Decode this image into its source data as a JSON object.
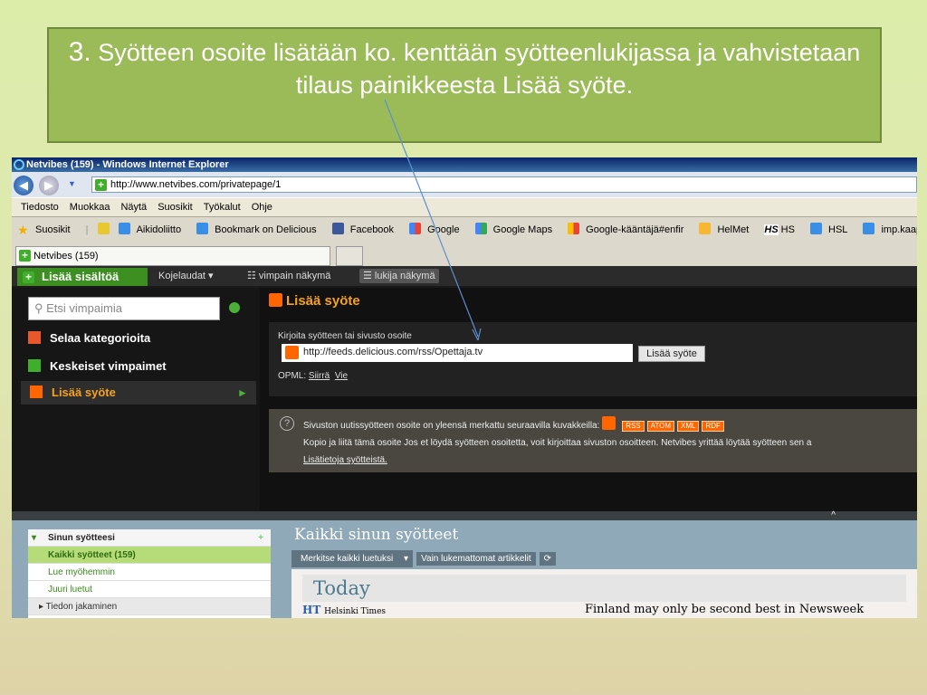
{
  "slide": {
    "number": "3.",
    "text": "Syötteen osoite lisätään ko. kenttään syötteenlukijassa ja vahvistetaan tilaus painikkeesta Lisää syöte."
  },
  "browser": {
    "title": "Netvibes (159) - Windows Internet Explorer",
    "url": "http://www.netvibes.com/privatepage/1",
    "menu": [
      "Tiedosto",
      "Muokkaa",
      "Näytä",
      "Suosikit",
      "Työkalut",
      "Ohje"
    ],
    "favorites_label": "Suosikit",
    "bookmarks": [
      "Aikidoliitto",
      "Bookmark on Delicious",
      "Facebook",
      "Google",
      "Google Maps",
      "Google-kääntäjä#enfir",
      "HelMet",
      "HS",
      "HSL",
      "imp.kaapeli"
    ],
    "tab": "Netvibes (159)"
  },
  "netvibes": {
    "add_content": "Lisää sisältöä",
    "dashboards": "Kojelaudat",
    "widget_view": "vimpain näkymä",
    "reader_view": "lukija näkymä",
    "search_placeholder": "Etsi vimpaimia",
    "sidebar": [
      "Selaa kategorioita",
      "Keskeiset vimpaimet",
      "Lisää syöte"
    ],
    "heading": "Lisää syöte",
    "form_label": "Kirjoita syötteen tai sivusto osoite",
    "feed_url": "http://feeds.delicious.com/rss/Opettaja.tv",
    "add_feed": "Lisää syöte",
    "opml_label": "OPML:",
    "opml_import": "Siirrä",
    "opml_export": "Vie",
    "info1": "Sivuston uutissyötteen osoite on yleensä merkattu seuraavilla kuvakkeilla:",
    "tags": [
      "RSS",
      "ATOM",
      "XML",
      "RDF"
    ],
    "info2": "Kopio ja liitä tämä osoite Jos et löydä syötteen osoitetta, voit kirjoittaa sivuston osoitteen. Netvibes yrittää löytää syötteen sen a",
    "info_link": "Lisätietoja syötteistä."
  },
  "reader": {
    "feeds_header": "Sinun syötteesi",
    "all_feeds": "Kaikki syötteet (159)",
    "read_later": "Lue myöhemmin",
    "just_read": "Juuri luetut",
    "sharing": "Tiedon jakaminen",
    "title": "Kaikki sinun syötteet",
    "mark_all": "Merkitse kaikki luetuksi",
    "unread_only": "Vain lukemattomat artikkelit",
    "today": "Today",
    "source_abbr": "HT",
    "source": "Helsinki Times",
    "headline": "Finland may only be second best in Newsweek ranking"
  }
}
